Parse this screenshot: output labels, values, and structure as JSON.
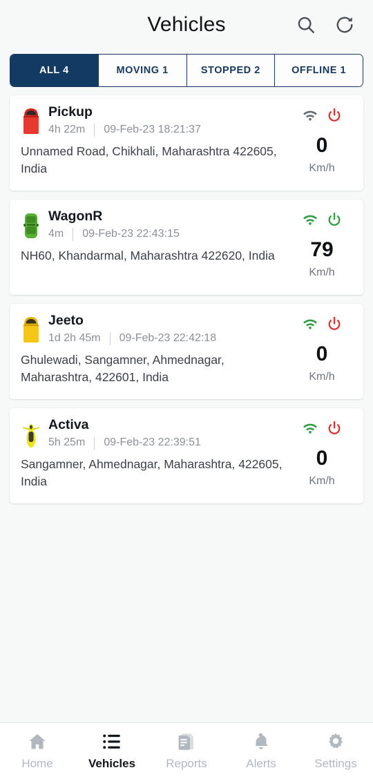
{
  "header": {
    "title": "Vehicles",
    "search_icon": "search-icon",
    "refresh_icon": "refresh-icon"
  },
  "filter_tabs": [
    {
      "label": "All 4",
      "active": true
    },
    {
      "label": "MOVING 1",
      "active": false
    },
    {
      "label": "STOPPED 2",
      "active": false
    },
    {
      "label": "OFFLINE 1",
      "active": false
    }
  ],
  "colors": {
    "primary_navy": "#123a63",
    "tab_border": "#17375e",
    "online_green": "#2e9e43",
    "offline_red": "#e03131",
    "inactive_grey": "#6f757c",
    "page_bg": "#f7f8f8"
  },
  "vehicles": [
    {
      "name": "Pickup",
      "duration": "4h 22m",
      "timestamp": "09-Feb-23 18:21:37",
      "address": "Unnamed Road, Chikhali, Maharashtra 422605, India",
      "speed": "0",
      "unit": "Km/h",
      "vehicle_type": "truck",
      "vehicle_color": "#e8392f",
      "signal_icon": "wifi-icon",
      "signal_color": "#62686f",
      "power_icon": "power-icon",
      "power_color": "#e03131"
    },
    {
      "name": "WagonR",
      "duration": "4m",
      "timestamp": "09-Feb-23 22:43:15",
      "address": "NH60, Khandarmal, Maharashtra 422620, India",
      "speed": "79",
      "unit": "Km/h",
      "vehicle_type": "car",
      "vehicle_color": "#56b033",
      "signal_icon": "wifi-icon",
      "signal_color": "#2e9e43",
      "power_icon": "power-icon",
      "power_color": "#2e9e43"
    },
    {
      "name": "Jeeto",
      "duration": "1d 2h 45m",
      "timestamp": "09-Feb-23 22:42:18",
      "address": "Ghulewadi, Sangamner, Ahmednagar, Maharashtra, 422601, India",
      "speed": "0",
      "unit": "Km/h",
      "vehicle_type": "truck",
      "vehicle_color": "#f4c716",
      "signal_icon": "wifi-icon",
      "signal_color": "#2e9e43",
      "power_icon": "power-icon",
      "power_color": "#e03131"
    },
    {
      "name": "Activa",
      "duration": "5h 25m",
      "timestamp": "09-Feb-23 22:39:51",
      "address": "Sangamner, Ahmednagar, Maharashtra, 422605, India",
      "speed": "0",
      "unit": "Km/h",
      "vehicle_type": "scooter",
      "vehicle_color": "#ece51a",
      "signal_icon": "wifi-icon",
      "signal_color": "#2e9e43",
      "power_icon": "power-icon",
      "power_color": "#e03131"
    }
  ],
  "bottom_nav": [
    {
      "label": "Home",
      "icon": "home-icon",
      "active": false
    },
    {
      "label": "Vehicles",
      "icon": "list-icon",
      "active": true
    },
    {
      "label": "Reports",
      "icon": "document-icon",
      "active": false
    },
    {
      "label": "Alerts",
      "icon": "bell-icon",
      "active": false
    },
    {
      "label": "Settings",
      "icon": "gear-icon",
      "active": false
    }
  ]
}
